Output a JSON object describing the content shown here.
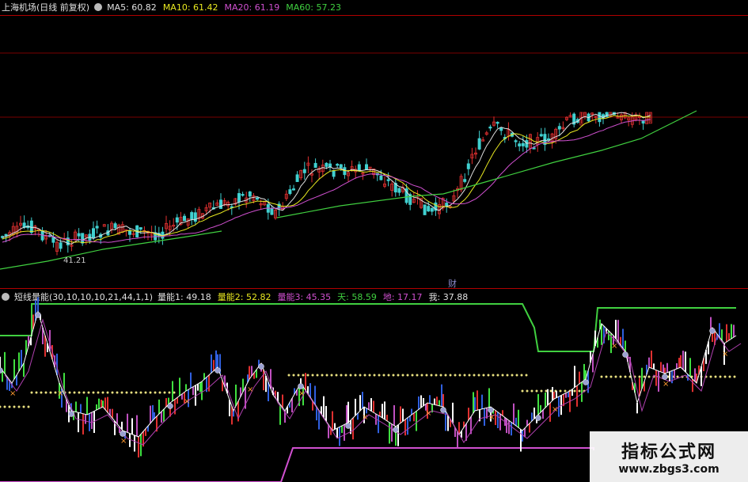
{
  "header_top": {
    "title": "上海机场(日线 前复权)",
    "ma": [
      {
        "label": "MA5: 60.82",
        "color": "#e0e0e0"
      },
      {
        "label": "MA10: 61.42",
        "color": "#e8e820"
      },
      {
        "label": "MA20: 61.19",
        "color": "#d050d0"
      },
      {
        "label": "MA60: 57.23",
        "color": "#40d040"
      }
    ]
  },
  "header_bottom": {
    "title": "短线量能(30,10,10,10,21,44,1,1)",
    "items": [
      {
        "label": "量能1: 49.18",
        "color": "#e0e0e0"
      },
      {
        "label": "量能2: 52.82",
        "color": "#e8e820"
      },
      {
        "label": "量能3: 45.35",
        "color": "#d050d0"
      },
      {
        "label": "天: 58.59",
        "color": "#40d040"
      },
      {
        "label": "地: 17.17",
        "color": "#d050d0"
      },
      {
        "label": "我: 37.88",
        "color": "#e0e0e0"
      }
    ]
  },
  "top_chart": {
    "low_label": "41.21",
    "finance_mark": "财",
    "colors": {
      "up": "#e03030",
      "down": "#40d0d0",
      "ma5": "#e0e0e0",
      "ma10": "#e8e820",
      "ma20": "#d050d0",
      "ma60": "#40d040"
    }
  },
  "bottom_chart": {
    "colors": {
      "tian": "#40d040",
      "di": "#d050d0",
      "dots": "#e8e080",
      "line1": "#ffffff",
      "line3": "#b040b0"
    }
  },
  "watermark": {
    "title": "指标公式网",
    "url": "www.zbgs3.com"
  }
}
